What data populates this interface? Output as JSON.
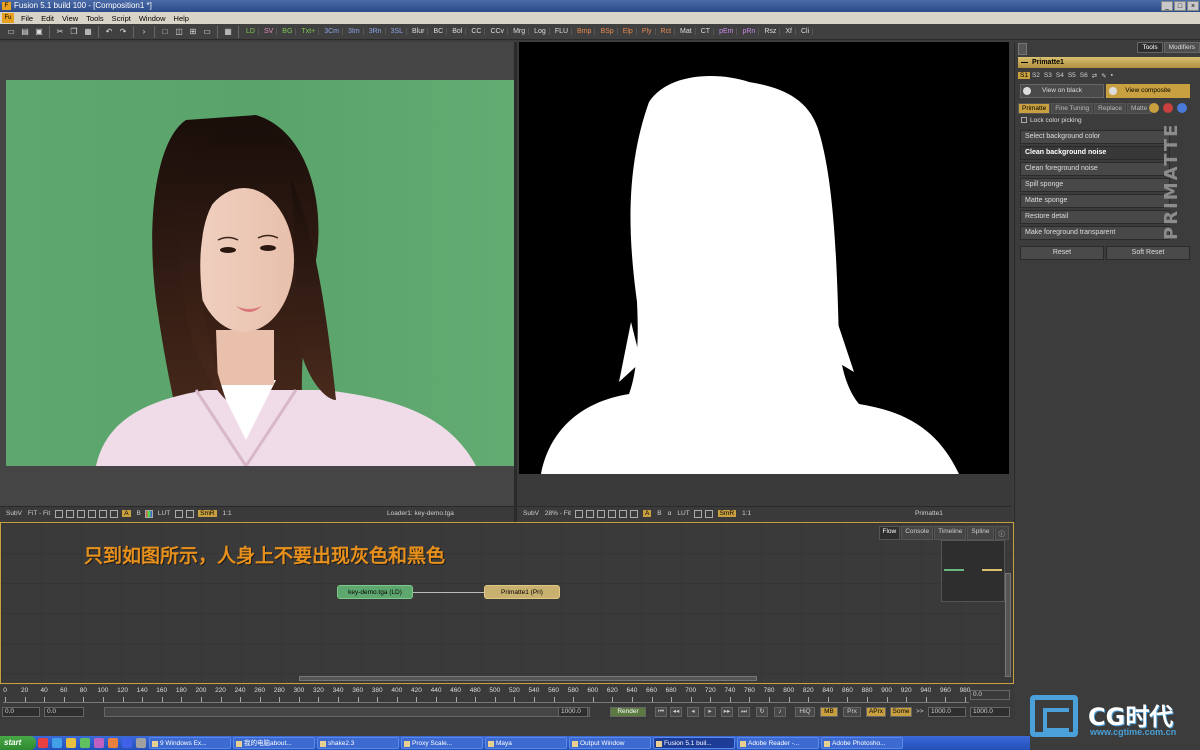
{
  "window": {
    "title": "Fusion 5.1 build 100 - [Composition1 *]",
    "buttons": [
      "_",
      "□",
      "×"
    ]
  },
  "menu": [
    "File",
    "Edit",
    "View",
    "Tools",
    "Script",
    "Window",
    "Help"
  ],
  "toolbar": {
    "groups": [
      {
        "label": "LD",
        "color": "green"
      },
      {
        "label": "SV",
        "color": "pink"
      },
      {
        "label": "BG",
        "color": "green"
      },
      {
        "label": "Txt+",
        "color": "green"
      },
      {
        "label": "3Cm",
        "color": "blue"
      },
      {
        "label": "3Im",
        "color": "blue"
      },
      {
        "label": "3Rn",
        "color": "blue"
      },
      {
        "label": "3SL",
        "color": "blue"
      },
      {
        "label": "Blur",
        "color": "white"
      },
      {
        "label": "BC",
        "color": "white"
      },
      {
        "label": "Bol",
        "color": "white"
      },
      {
        "label": "CC",
        "color": "white"
      },
      {
        "label": "CCv",
        "color": "white"
      },
      {
        "label": "Mrg",
        "color": "white"
      },
      {
        "label": "Log",
        "color": "white"
      },
      {
        "label": "FLU",
        "color": "white"
      },
      {
        "label": "Bmp",
        "color": "orange"
      },
      {
        "label": "BSp",
        "color": "orange"
      },
      {
        "label": "Elp",
        "color": "orange"
      },
      {
        "label": "Ply",
        "color": "orange"
      },
      {
        "label": "Rct",
        "color": "orange"
      },
      {
        "label": "Mat",
        "color": "white"
      },
      {
        "label": "CT",
        "color": "white"
      },
      {
        "label": "pEm",
        "color": "purple"
      },
      {
        "label": "pRn",
        "color": "purple"
      },
      {
        "label": "Rsz",
        "color": "white"
      },
      {
        "label": "Xf",
        "color": "white"
      },
      {
        "label": "Cli",
        "color": "white"
      }
    ]
  },
  "viewer_left": {
    "subv": "SubV",
    "fit": "FiT",
    "fit2": "Fit",
    "lut": "LUT",
    "smr": "SmR",
    "ratio": "1:1",
    "name": "Loader1: key-demo.tga",
    "a": "A",
    "b": "B"
  },
  "viewer_right": {
    "subv": "SubV",
    "zoom": "28%",
    "fit": "Fit",
    "lut": "LUT",
    "smr": "SmR",
    "ratio": "1:1",
    "name": "Primatte1",
    "a": "A",
    "b": "B",
    "alpha": "α"
  },
  "panel": {
    "tabs": [
      "Tools",
      "Modifiers"
    ],
    "tool_name": "Primatte1",
    "sub_tabs": [
      "S1",
      "S2",
      "S3",
      "S4",
      "S5",
      "S6"
    ],
    "view_on_black": "View on black",
    "view_composite": "View composite",
    "primatte_tabs": [
      "Primatte",
      "Fine Tuning",
      "Replace",
      "Matte"
    ],
    "lock_label": "Lock color picking",
    "ops": [
      "Select background color",
      "Clean background noise",
      "Clean foreground noise",
      "Spill sponge",
      "Matte sponge",
      "Restore detail",
      "Make foreground transparent"
    ],
    "logo": "PRIMATTE",
    "reset": "Reset",
    "soft_reset": "Soft Reset"
  },
  "flow": {
    "tabs": [
      "Flow",
      "Console",
      "Timeline",
      "Spline"
    ],
    "annotation": "只到如图所示，人身上不要出现灰色和黑色",
    "node_loader": "key-demo.tga  (LD)",
    "node_primatte": "Primatte1  (Pri)"
  },
  "timeline": {
    "ticks": [
      "0",
      "20",
      "40",
      "60",
      "80",
      "100",
      "120",
      "140",
      "160",
      "180",
      "200",
      "220",
      "240",
      "260",
      "280",
      "300",
      "320",
      "340",
      "360",
      "380",
      "400",
      "420",
      "440",
      "460",
      "480",
      "500",
      "520",
      "540",
      "560",
      "580",
      "600",
      "620",
      "640",
      "660",
      "680",
      "700",
      "720",
      "740",
      "760",
      "780",
      "800",
      "820",
      "840",
      "860",
      "880",
      "900",
      "920",
      "940",
      "960",
      "980"
    ],
    "current": "0.0"
  },
  "transport": {
    "start": "0.0",
    "global_start": "0.0",
    "render": "Render",
    "end_field": "1000.0",
    "hq": "HiQ",
    "mb": "MB",
    "prx": "Prx",
    "aprx": "APrx",
    "some": "Some",
    "render_end": "1000.0",
    "global_end": "1000.0",
    "step": ">>"
  },
  "taskbar": {
    "start": "start",
    "tasks": [
      "9 Windows Ex...",
      "我的电脑about...",
      "shake2.3",
      "Proxy Scale...",
      "Maya",
      "Output Window",
      "Fusion 5.1 buil...",
      "Adobe Reader -...",
      "Adobe Photosho..."
    ],
    "active_index": 6
  },
  "watermark": {
    "brand": "CG时代",
    "url": "www.cgtime.com.cn"
  }
}
